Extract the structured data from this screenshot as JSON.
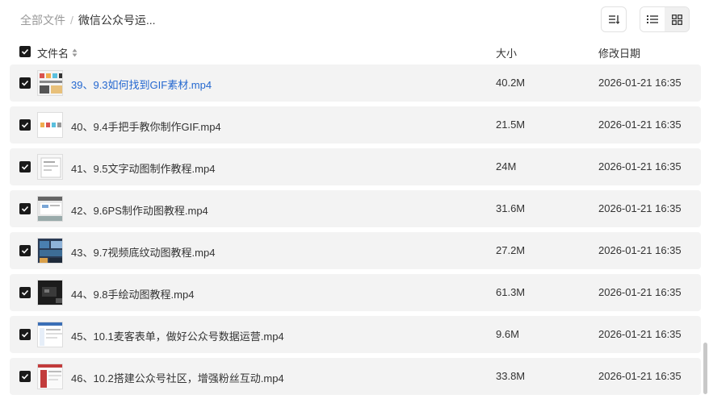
{
  "breadcrumb": {
    "root": "全部文件",
    "separator": "/",
    "current": "微信公众号运..."
  },
  "header": {
    "name": "文件名",
    "size": "大小",
    "modified": "修改日期"
  },
  "files": [
    {
      "name": "39、9.3如何找到GIF素材.mp4",
      "size": "40.2M",
      "date": "2026-01-21 16:35",
      "thumb": "thumb-a",
      "active": true
    },
    {
      "name": "40、9.4手把手教你制作GIF.mp4",
      "size": "21.5M",
      "date": "2026-01-21 16:35",
      "thumb": "thumb-b",
      "active": false
    },
    {
      "name": "41、9.5文字动图制作教程.mp4",
      "size": "24M",
      "date": "2026-01-21 16:35",
      "thumb": "thumb-c",
      "active": false
    },
    {
      "name": "42、9.6PS制作动图教程.mp4",
      "size": "31.6M",
      "date": "2026-01-21 16:35",
      "thumb": "thumb-d",
      "active": false
    },
    {
      "name": "43、9.7视频底纹动图教程.mp4",
      "size": "27.2M",
      "date": "2026-01-21 16:35",
      "thumb": "thumb-e",
      "active": false
    },
    {
      "name": "44、9.8手绘动图教程.mp4",
      "size": "61.3M",
      "date": "2026-01-21 16:35",
      "thumb": "thumb-f",
      "active": false
    },
    {
      "name": "45、10.1麦客表单，做好公众号数据运营.mp4",
      "size": "9.6M",
      "date": "2026-01-21 16:35",
      "thumb": "thumb-g",
      "active": false
    },
    {
      "name": "46、10.2搭建公众号社区，增强粉丝互动.mp4",
      "size": "33.8M",
      "date": "2026-01-21 16:35",
      "thumb": "thumb-h",
      "active": false
    }
  ],
  "colors": {
    "accent": "#2468d0",
    "row_bg": "#f3f3f3",
    "checkbox": "#1a1a1a"
  }
}
